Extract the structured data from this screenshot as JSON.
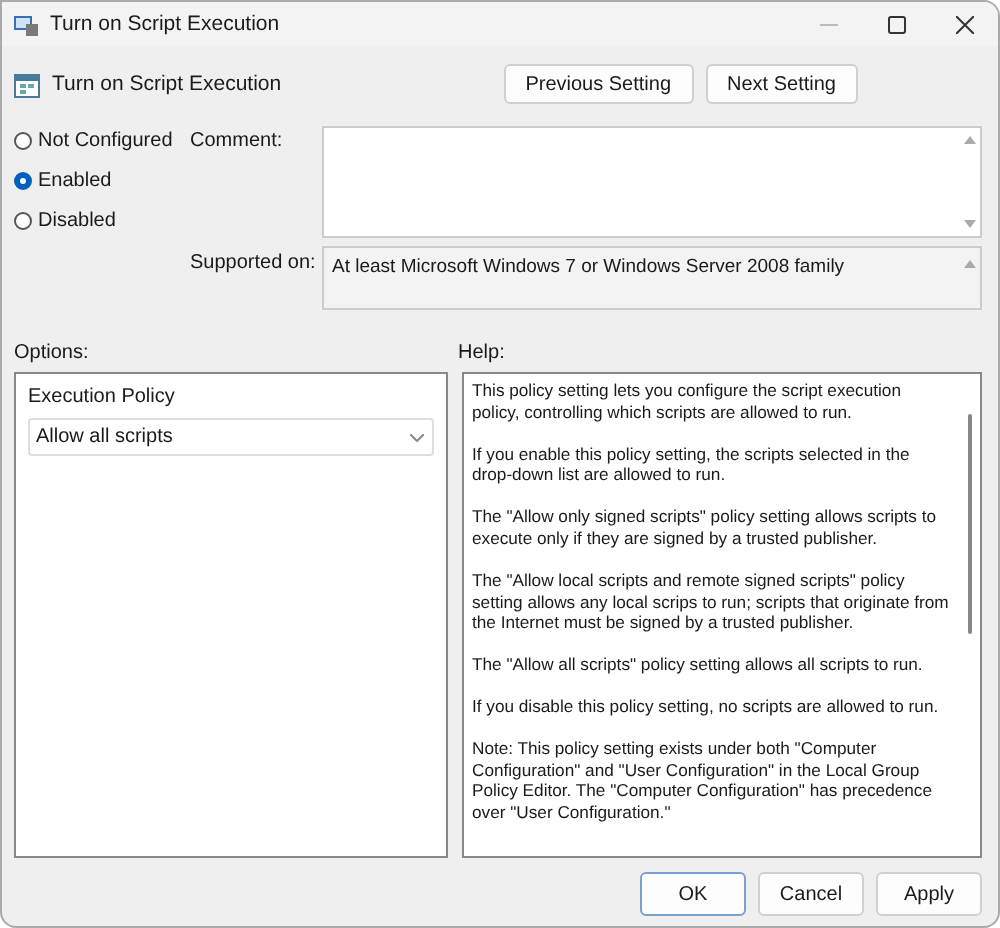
{
  "window": {
    "title": "Turn on Script Execution"
  },
  "header": {
    "title": "Turn on Script Execution",
    "buttons": [
      "Previous Setting",
      "Next Setting"
    ]
  },
  "state_options": [
    {
      "label": "Not Configured",
      "selected": false
    },
    {
      "label": "Enabled",
      "selected": true
    },
    {
      "label": "Disabled",
      "selected": false
    }
  ],
  "comment": {
    "label": "Comment:"
  },
  "supported_on": {
    "label": "Supported on:",
    "value": "At least Microsoft Windows 7 or Windows Server 2008 family"
  },
  "options": {
    "label": "Options:",
    "policy_label": "Execution Policy",
    "policy_value": "Allow all scripts"
  },
  "help": {
    "label": "Help:",
    "paragraphs": [
      "This policy setting lets you configure the script execution policy, controlling which scripts are allowed to run.",
      "If you enable this policy setting, the scripts selected in the drop-down list are allowed to run.",
      "The \"Allow only signed scripts\" policy setting allows scripts to execute only if they are signed by a trusted publisher.",
      "The \"Allow local scripts and remote signed scripts\" policy setting allows any local scrips to run; scripts that originate from the Internet must be signed by a trusted publisher.",
      "The \"Allow all scripts\" policy setting allows all scripts to run.",
      "If you disable this policy setting, no scripts are allowed to run.",
      "Note: This policy setting exists under both \"Computer Configuration\" and \"User Configuration\" in the Local Group Policy Editor. The \"Computer Configuration\" has precedence over \"User Configuration.\""
    ]
  },
  "footer_buttons": [
    {
      "label": "OK",
      "kind": "default"
    },
    {
      "label": "Cancel",
      "kind": "normal"
    },
    {
      "label": "Apply",
      "kind": "normal"
    }
  ]
}
